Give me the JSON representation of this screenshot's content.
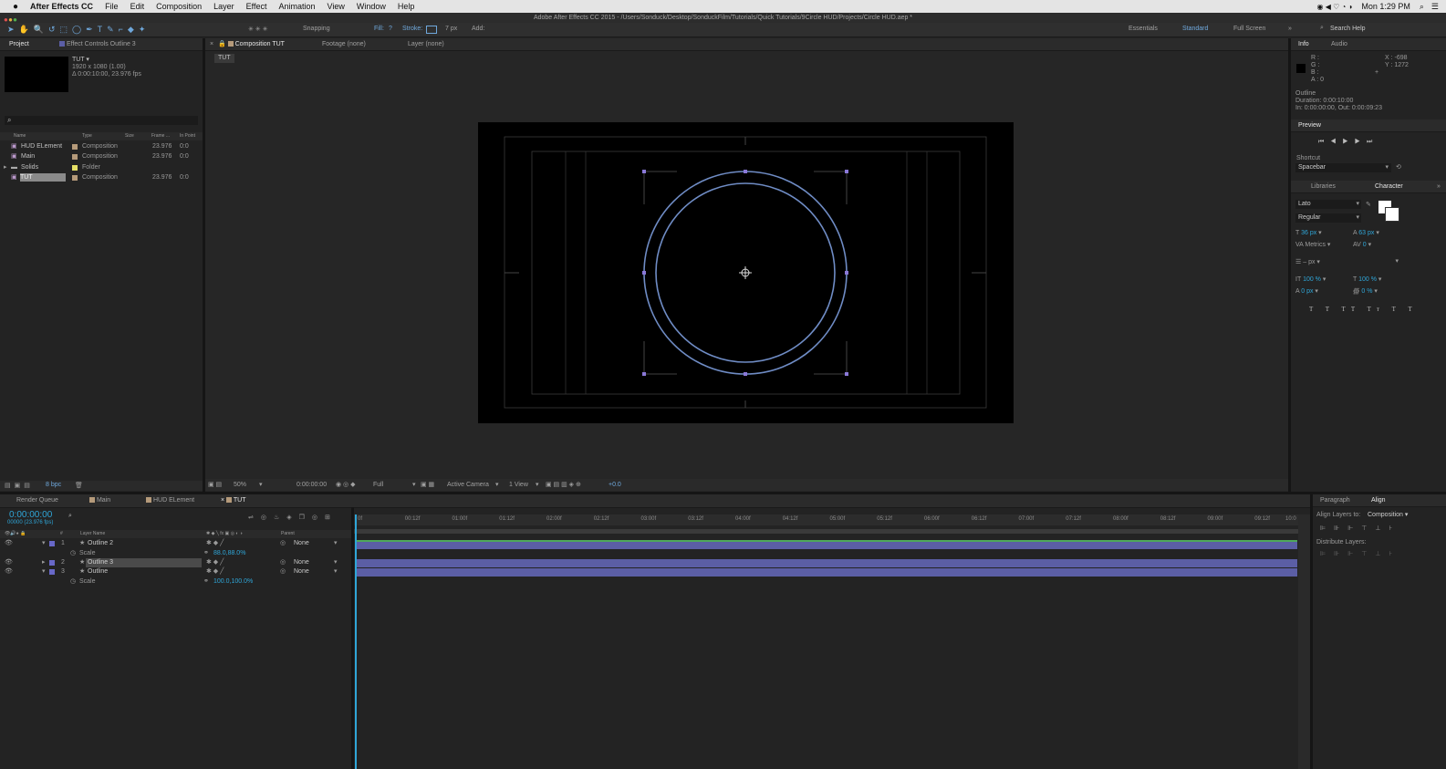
{
  "menubar": {
    "apple": "",
    "app": "After Effects CC",
    "items": [
      "File",
      "Edit",
      "Composition",
      "Layer",
      "Effect",
      "Animation",
      "View",
      "Window",
      "Help"
    ],
    "clock": "Mon 1:29 PM"
  },
  "window_title": "Adobe After Effects CC 2015 - /Users/Sonduck/Desktop/SonduckFilm/Tutorials/Quick Tutorials/9Circle HUD/Projects/Circle HUD.aep *",
  "toolbar": {
    "snapping": "Snapping",
    "fill_label": "Fill:",
    "fill_value": "?",
    "stroke_label": "Stroke:",
    "stroke_value": "7 px",
    "add_label": "Add:",
    "workspaces": [
      "Essentials",
      "Standard",
      "Full Screen"
    ],
    "active_workspace": "Standard",
    "search_help": "Search Help"
  },
  "project_panel": {
    "tabs": [
      "Project",
      "Effect Controls Outline 3"
    ],
    "comp_name": "TUT ▾",
    "comp_size": "1920 x 1080 (1.00)",
    "comp_duration": "Δ 0:00:10:00, 23.976 fps",
    "columns": [
      "Name",
      "Type",
      "Size",
      "Frame ...",
      "In Point"
    ],
    "items": [
      {
        "name": "HUD ELement",
        "type": "Composition",
        "fps": "23.976",
        "in": "0:0",
        "color": "#b59a7a"
      },
      {
        "name": "Main",
        "type": "Composition",
        "fps": "23.976",
        "in": "0:0",
        "color": "#b59a7a"
      },
      {
        "name": "Solids",
        "type": "Folder",
        "fps": "",
        "in": "",
        "color": "#e6e066"
      },
      {
        "name": "TUT",
        "type": "Composition",
        "fps": "23.976",
        "in": "0:0",
        "color": "#b59a7a"
      }
    ],
    "bpc": "8 bpc"
  },
  "viewer": {
    "tabs": [
      "Composition TUT",
      "Footage (none)",
      "Layer (none)"
    ],
    "crumb": "TUT",
    "zoom": "50%",
    "time": "0:00:00:00",
    "quality": "Full",
    "camera": "Active Camera",
    "view": "1 View",
    "exposure": "+0.0"
  },
  "info_panel": {
    "tabs": [
      "Info",
      "Audio"
    ],
    "r": "R :",
    "g": "G :",
    "b": "B :",
    "a": "A : 0",
    "x": "X : -698",
    "y": "Y : 1272",
    "layer": "Outline",
    "duration": "Duration: 0:00:10:00",
    "inout": "In: 0:00:00:00, Out: 0:00:09:23"
  },
  "preview_panel": {
    "title": "Preview",
    "shortcut_label": "Shortcut",
    "shortcut_value": "Spacebar"
  },
  "character_panel": {
    "tabs": [
      "Libraries",
      "Character"
    ],
    "font": "Lato",
    "style": "Regular",
    "size": "36 px",
    "leading": "63 px",
    "kerning": "Metrics",
    "tracking": "0",
    "stroke_width": "– px",
    "vscale": "100 %",
    "hscale": "100 %",
    "baseline": "0 px",
    "tsume": "0 %"
  },
  "timeline": {
    "tabs": [
      "Render Queue",
      "Main",
      "HUD ELement",
      "TUT"
    ],
    "time": "0:00:00:00",
    "frame": "00000 (23.976 fps)",
    "columns": [
      "#",
      "Layer Name",
      "Parent"
    ],
    "layers": [
      {
        "num": "1",
        "name": "Outline 2",
        "parent": "None",
        "expanded": true
      },
      {
        "num": "",
        "name": "Scale",
        "value": "88.0,88.0%"
      },
      {
        "num": "2",
        "name": "Outline 3",
        "parent": "None",
        "expanded": false
      },
      {
        "num": "3",
        "name": "Outline",
        "parent": "None",
        "expanded": true
      },
      {
        "num": "",
        "name": "Scale",
        "value": "100.0,100.0%"
      }
    ],
    "ruler": [
      "0f",
      "00:12f",
      "01:00f",
      "01:12f",
      "02:00f",
      "02:12f",
      "03:00f",
      "03:12f",
      "04:00f",
      "04:12f",
      "05:00f",
      "05:12f",
      "06:00f",
      "06:12f",
      "07:00f",
      "07:12f",
      "08:00f",
      "08:12f",
      "09:00f",
      "09:12f",
      "10:0"
    ]
  },
  "align_panel": {
    "tabs": [
      "Paragraph",
      "Align"
    ],
    "align_to_label": "Align Layers to:",
    "align_to_value": "Composition",
    "distribute": "Distribute Layers:"
  }
}
